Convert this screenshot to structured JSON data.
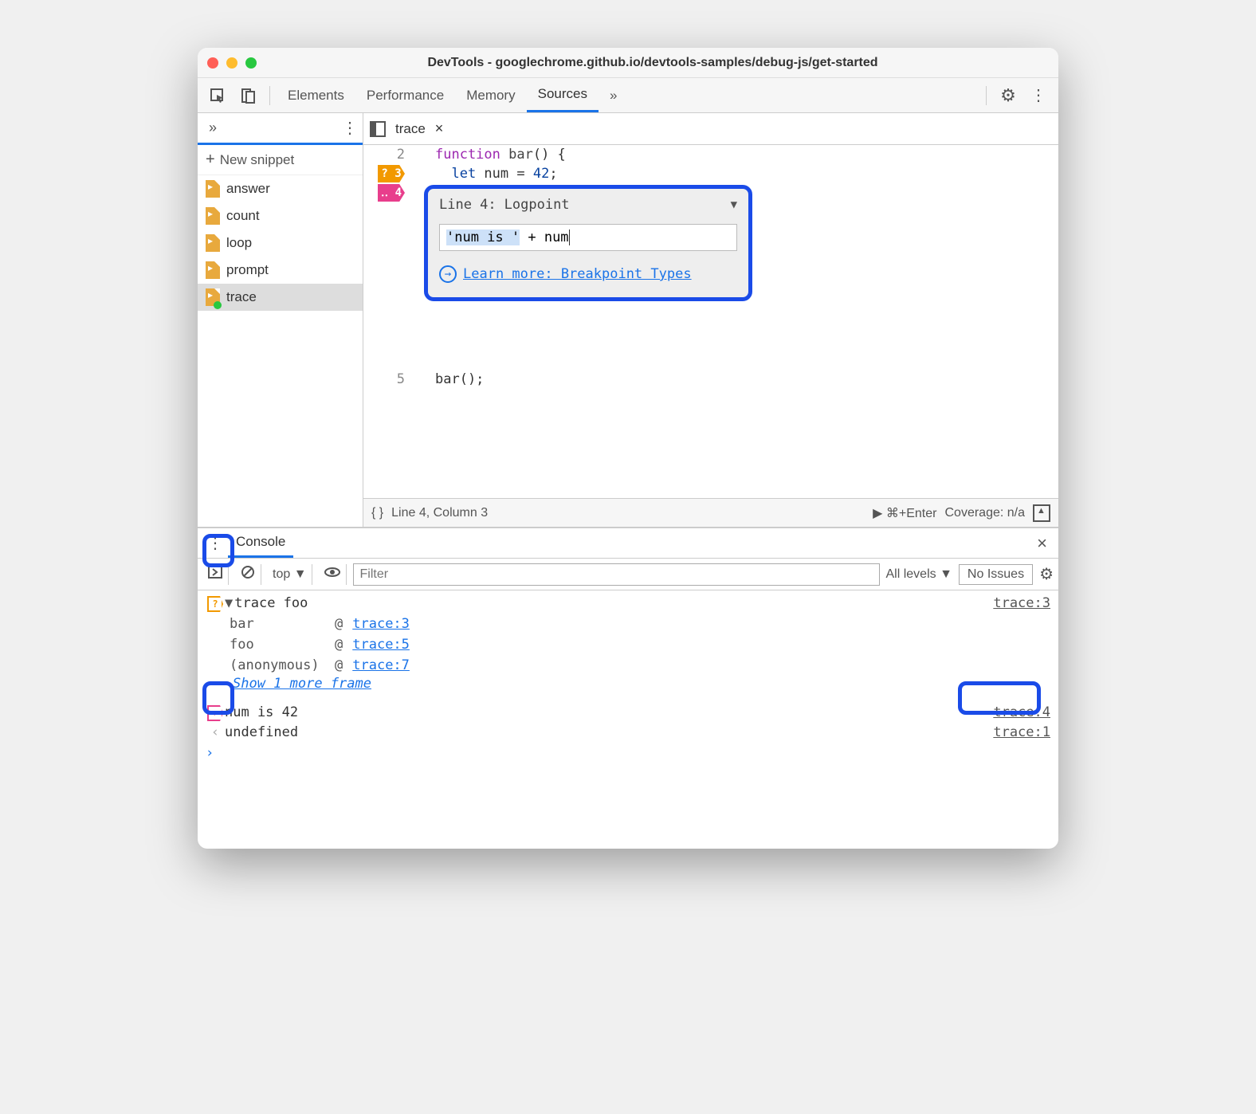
{
  "window": {
    "title": "DevTools - googlechrome.github.io/devtools-samples/debug-js/get-started"
  },
  "tabs": {
    "elements": "Elements",
    "performance": "Performance",
    "memory": "Memory",
    "sources": "Sources",
    "more": "»"
  },
  "sidebar": {
    "chevron": "»",
    "new_snippet": "New snippet",
    "items": [
      {
        "name": "answer"
      },
      {
        "name": "count"
      },
      {
        "name": "loop"
      },
      {
        "name": "prompt"
      },
      {
        "name": "trace"
      }
    ]
  },
  "editor": {
    "tab_name": "trace",
    "lines": {
      "l2": "function bar() {",
      "l2_kw": "function",
      "l2_fn": " bar",
      "l2_rest": "() {",
      "l3_kw": "  let",
      "l3_var": " num ",
      "l3_eq": "= ",
      "l3_val": "42",
      "l3_end": ";",
      "l4": "}",
      "l5": "bar();"
    },
    "gutter": {
      "n2": "2",
      "n3": "3",
      "n4": "4",
      "n5": "5",
      "bp3": "?",
      "bp4": "‥"
    }
  },
  "logpoint": {
    "line_label": "Line 4:",
    "type": "Logpoint",
    "input": "'num is ' + num",
    "input_seg1": "'num is '",
    "input_seg2": " + num",
    "learn": "Learn more: Breakpoint Types"
  },
  "status": {
    "braces": "{ }",
    "pos": "Line 4, Column 3",
    "run": "▶ ⌘+Enter",
    "coverage": "Coverage: n/a"
  },
  "console": {
    "tab": "Console",
    "context": "top ▼",
    "filter_ph": "Filter",
    "levels": "All levels ▼",
    "issues": "No Issues",
    "rows": {
      "r1_msg": "trace foo",
      "r1_src": "trace:3",
      "stack": [
        {
          "fn": "bar",
          "loc": "trace:3"
        },
        {
          "fn": "foo",
          "loc": "trace:5"
        },
        {
          "fn": "(anonymous)",
          "loc": "trace:7"
        }
      ],
      "showmore": "Show 1 more frame",
      "r2_msg": "num is 42",
      "r2_src": "trace:4",
      "r3_msg": "undefined",
      "r3_src": "trace:1"
    },
    "at": "@"
  }
}
